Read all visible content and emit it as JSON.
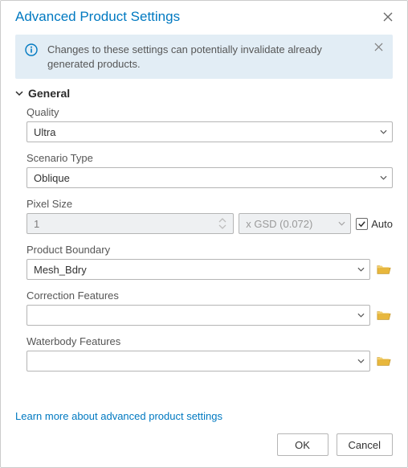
{
  "title": "Advanced Product Settings",
  "info": {
    "message": "Changes to these settings can potentially invalidate already generated products."
  },
  "section": {
    "general": "General"
  },
  "fields": {
    "quality": {
      "label": "Quality",
      "value": "Ultra"
    },
    "scenario": {
      "label": "Scenario Type",
      "value": "Oblique"
    },
    "pixel": {
      "label": "Pixel Size",
      "value": "1",
      "unit": "x GSD (0.072)",
      "auto_label": "Auto",
      "auto_checked": true
    },
    "boundary": {
      "label": "Product Boundary",
      "value": "Mesh_Bdry"
    },
    "correction": {
      "label": "Correction Features",
      "value": ""
    },
    "waterbody": {
      "label": "Waterbody Features",
      "value": ""
    }
  },
  "link": "Learn more about advanced product settings",
  "buttons": {
    "ok": "OK",
    "cancel": "Cancel"
  }
}
